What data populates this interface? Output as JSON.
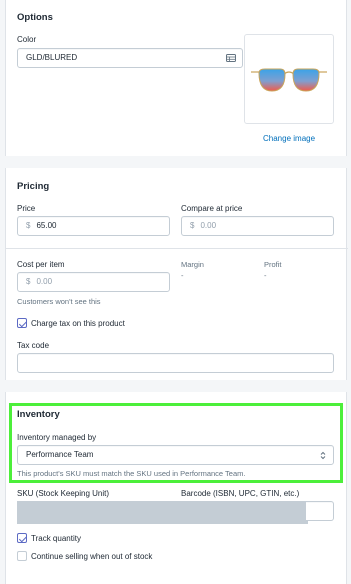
{
  "options": {
    "title": "Options",
    "color_label": "Color",
    "color_value": "GLD/BLURED",
    "table_icon": "table-icon",
    "product_image_icon": "sunglasses-image",
    "change_image": "Change image"
  },
  "pricing": {
    "title": "Pricing",
    "price_label": "Price",
    "currency": "$",
    "price_value": "65.00",
    "compare_label": "Compare at price",
    "compare_placeholder": "0.00",
    "cost_label": "Cost per item",
    "cost_placeholder": "0.00",
    "cost_hint": "Customers won't see this",
    "margin_label": "Margin",
    "margin_value": "-",
    "profit_label": "Profit",
    "profit_value": "-",
    "charge_tax_label": "Charge tax on this product",
    "charge_tax_checked": true,
    "tax_code_label": "Tax code",
    "tax_code_value": ""
  },
  "inventory": {
    "title": "Inventory",
    "managed_by_label": "Inventory managed by",
    "managed_by_value": "Performance Team",
    "select_icon": "chevron-updown-icon",
    "sku_hint": "This product's SKU must match the SKU used in Performance Team.",
    "sku_label": "SKU (Stock Keeping Unit)",
    "barcode_label": "Barcode (ISBN, UPC, GTIN, etc.)",
    "track_quantity_label": "Track quantity",
    "track_quantity_checked": true,
    "continue_selling_label": "Continue selling when out of stock",
    "continue_selling_checked": false
  },
  "colors": {
    "highlight": "#4cef3a",
    "link": "#006fbb",
    "checkbox_accent": "#5c6ac4",
    "sku_field_fill": "#c4cdd5"
  }
}
